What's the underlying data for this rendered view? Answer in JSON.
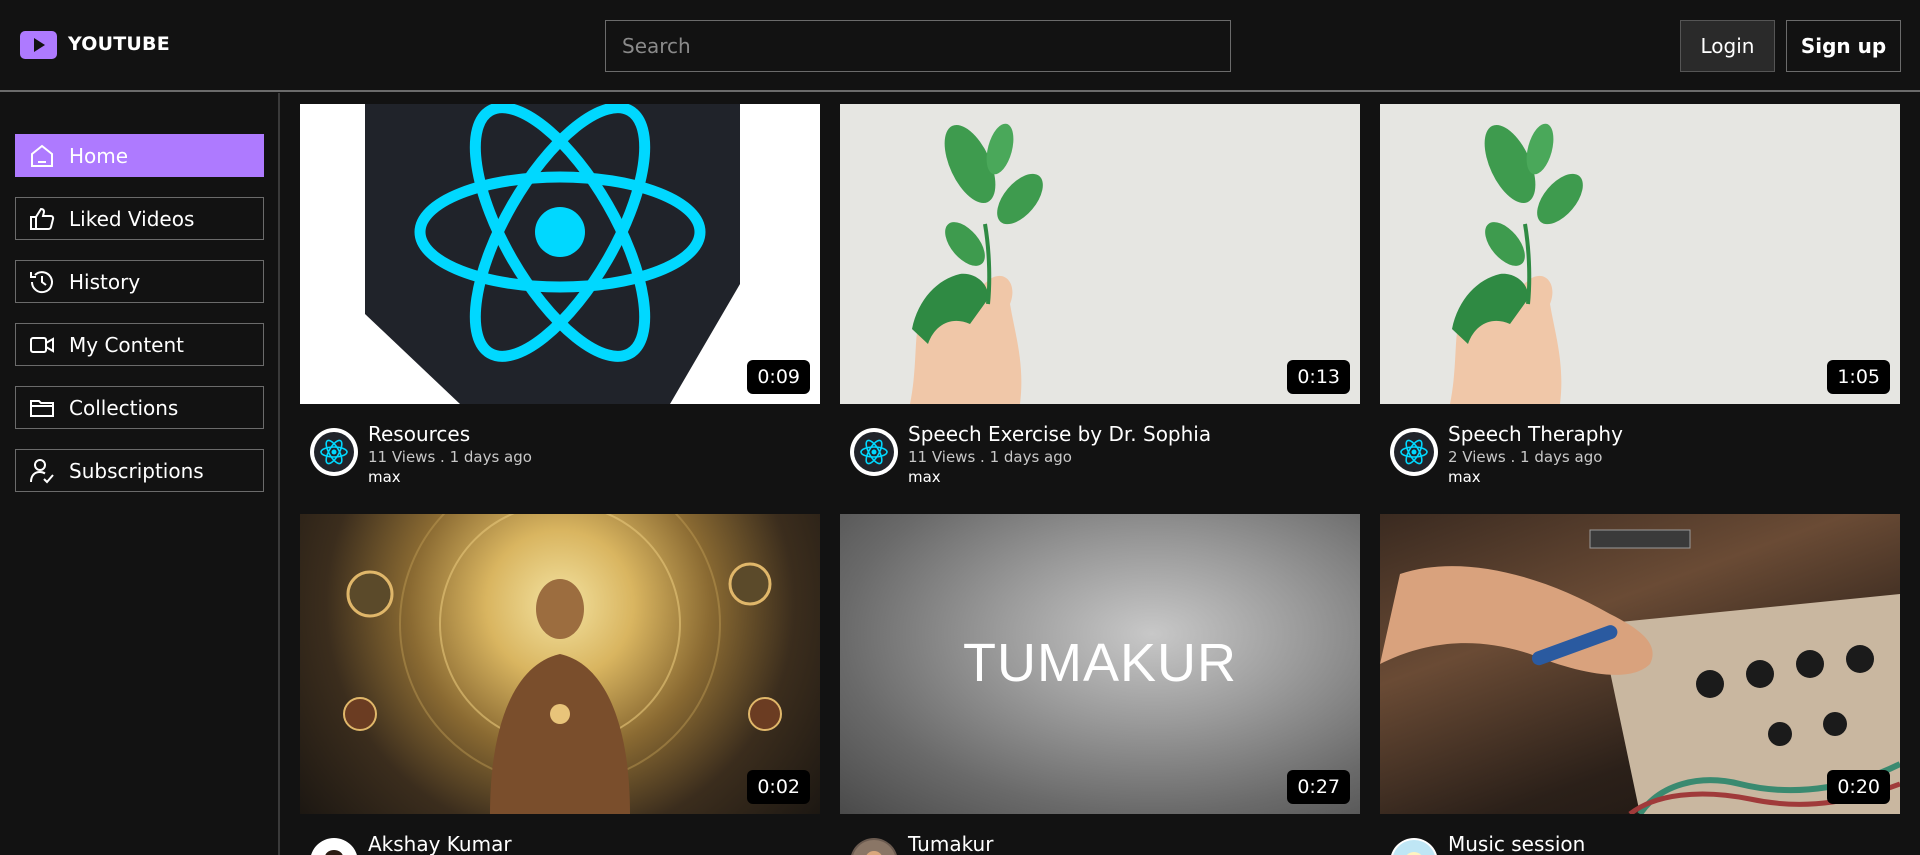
{
  "app": {
    "name": "YOUTUBE"
  },
  "header": {
    "search_placeholder": "Search",
    "login_label": "Login",
    "signup_label": "Sign up"
  },
  "sidebar": {
    "items": [
      {
        "label": "Home",
        "icon": "home-icon",
        "active": true
      },
      {
        "label": "Liked Videos",
        "icon": "thumbs-up-icon"
      },
      {
        "label": "History",
        "icon": "history-icon"
      },
      {
        "label": "My Content",
        "icon": "video-camera-icon"
      },
      {
        "label": "Collections",
        "icon": "folder-icon"
      },
      {
        "label": "Subscriptions",
        "icon": "user-check-icon"
      }
    ]
  },
  "videos": [
    {
      "title": "Resources",
      "stats": "11 Views . 1 days ago",
      "owner": "max",
      "duration": "0:09",
      "thumb": "react-logo"
    },
    {
      "title": "Speech Exercise by Dr. Sophia",
      "stats": "11 Views . 1 days ago",
      "owner": "max",
      "duration": "0:13",
      "thumb": "green-plant-hand"
    },
    {
      "title": "Speech Theraphy",
      "stats": "2 Views . 1 days ago",
      "owner": "max",
      "duration": "1:05",
      "thumb": "green-plant-hand"
    },
    {
      "title": "Akshay Kumar",
      "stats": "",
      "owner": "",
      "duration": "0:02",
      "thumb": "cosmic-meditation"
    },
    {
      "title": "Tumakur",
      "stats": "",
      "owner": "",
      "duration": "0:27",
      "thumb": "grey-text-card",
      "thumb_text": "TUMAKUR"
    },
    {
      "title": "Music session",
      "stats": "",
      "owner": "",
      "duration": "0:20",
      "thumb": "audio-interface"
    }
  ],
  "colors": {
    "accent": "#ae7aff",
    "background": "#121212",
    "react": "#00d8ff"
  }
}
